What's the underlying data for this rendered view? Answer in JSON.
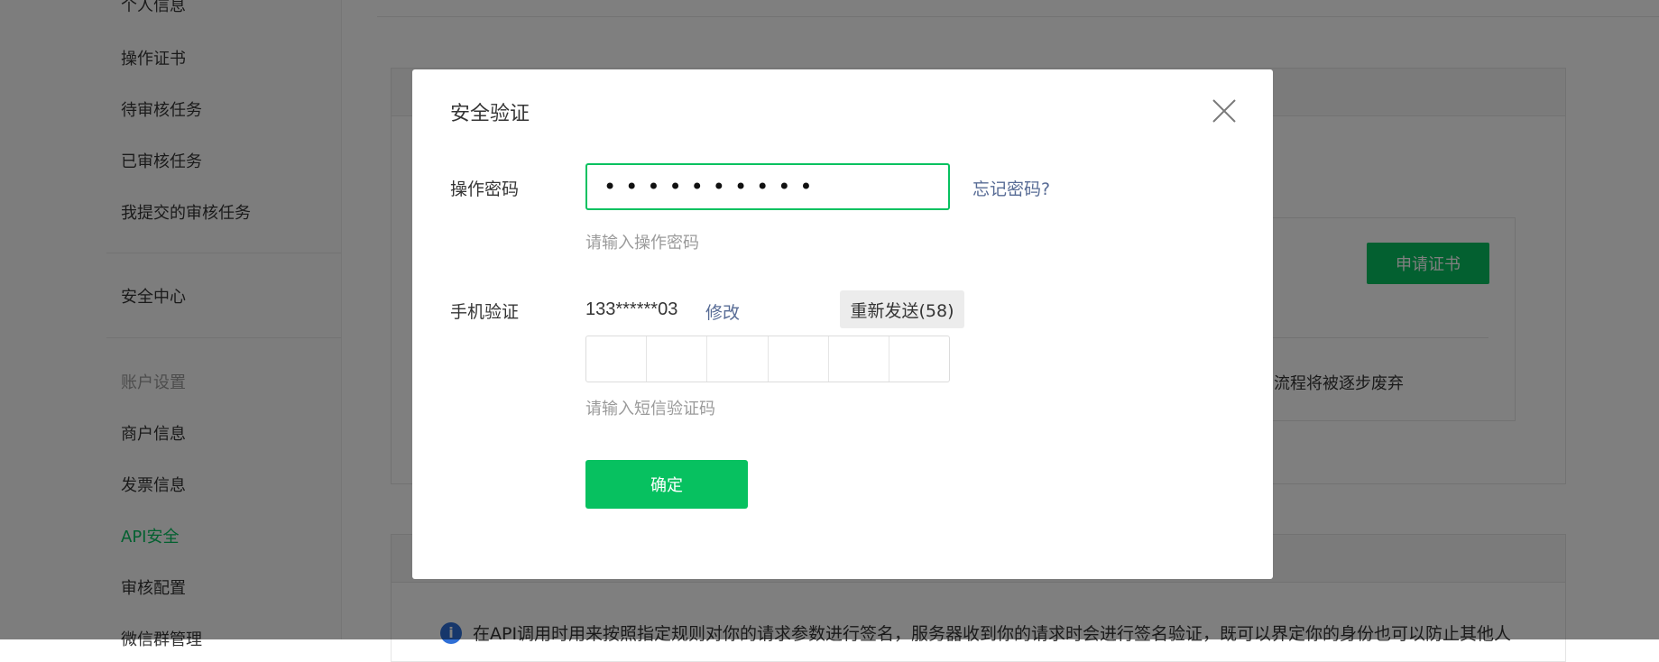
{
  "sidebar": {
    "items": [
      {
        "label": "个人信息",
        "style": "normal"
      },
      {
        "label": "操作证书",
        "style": "normal"
      },
      {
        "label": "待审核任务",
        "style": "normal"
      },
      {
        "label": "已审核任务",
        "style": "normal"
      },
      {
        "label": "我提交的审核任务",
        "style": "normal"
      },
      {
        "label": "安全中心",
        "style": "normal"
      },
      {
        "label": "账户设置",
        "style": "muted"
      },
      {
        "label": "商户信息",
        "style": "normal"
      },
      {
        "label": "发票信息",
        "style": "normal"
      },
      {
        "label": "API安全",
        "style": "active"
      },
      {
        "label": "审核配置",
        "style": "normal"
      },
      {
        "label": "微信群管理",
        "style": "normal"
      }
    ]
  },
  "main": {
    "apply_certificate_button": "申请证书",
    "deprecation_text": "流程将被逐步废弃",
    "notice_text": "在API调用时用来按照指定规则对你的请求参数进行签名，服务器收到你的请求时会进行签名验证，既可以界定你的身份也可以防止其他人"
  },
  "dialog": {
    "title": "安全验证",
    "password": {
      "label": "操作密码",
      "value": "••••••••••",
      "forgot_link": "忘记密码?",
      "hint": "请输入操作密码"
    },
    "phone": {
      "label": "手机验证",
      "number": "133******03",
      "modify_link": "修改",
      "resend_button": "重新发送(58)",
      "code_digits": 6,
      "hint": "请输入短信验证码"
    },
    "confirm_button": "确定"
  },
  "colors": {
    "brand_green": "#07c160",
    "link_blue": "#576b95",
    "overlay": "rgba(0,0,0,0.5)"
  }
}
